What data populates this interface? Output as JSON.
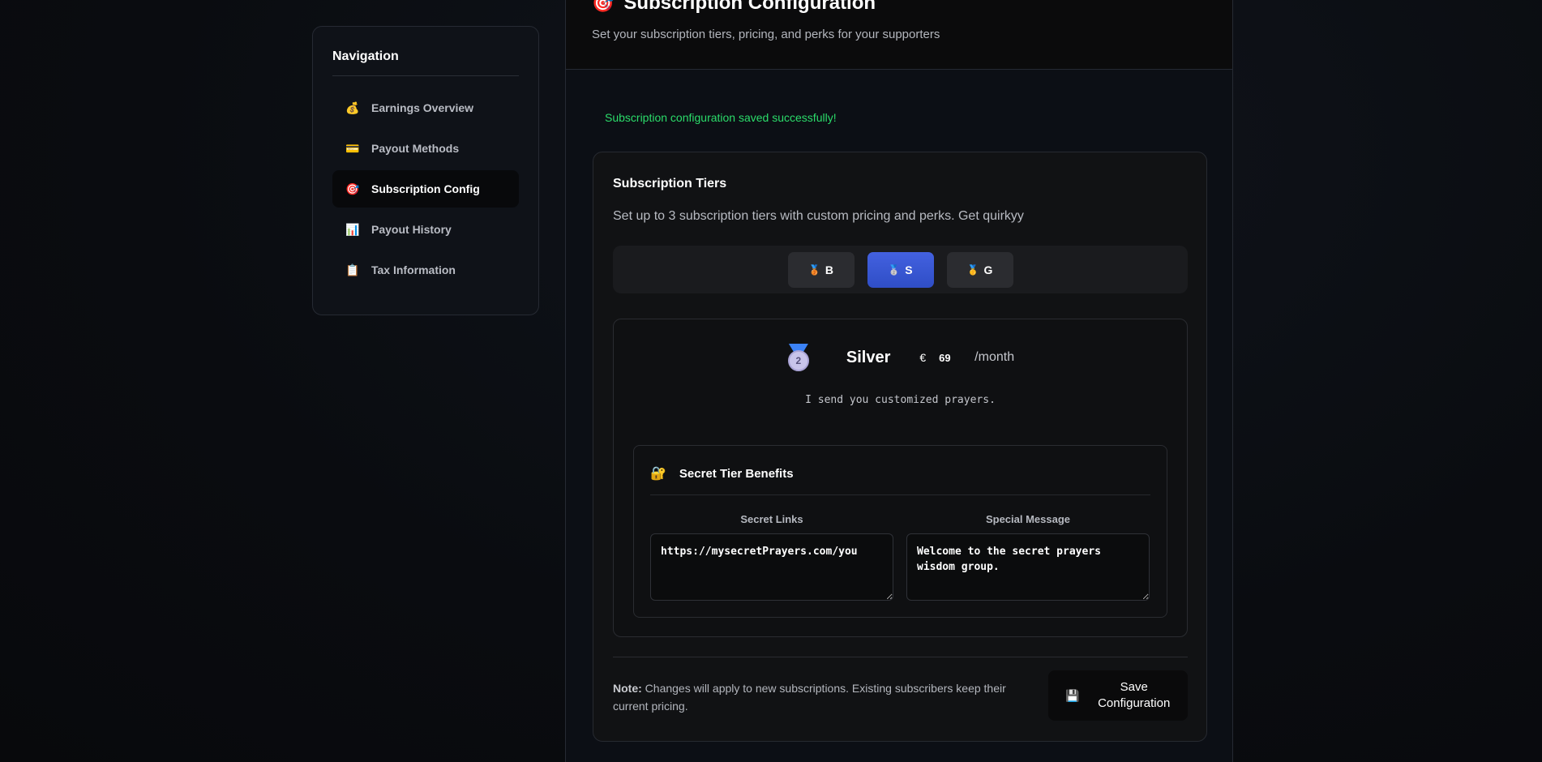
{
  "sidebar": {
    "title": "Navigation",
    "items": [
      {
        "icon": "💰",
        "label": "Earnings Overview"
      },
      {
        "icon": "💳",
        "label": "Payout Methods"
      },
      {
        "icon": "🎯",
        "label": "Subscription Config"
      },
      {
        "icon": "📊",
        "label": "Payout History"
      },
      {
        "icon": "📋",
        "label": "Tax Information"
      }
    ]
  },
  "header": {
    "icon": "🎯",
    "title": "Subscription Configuration",
    "subtitle": "Set your subscription tiers, pricing, and perks for your supporters"
  },
  "status": {
    "message": "Subscription configuration saved successfully!"
  },
  "tiers_card": {
    "title": "Subscription Tiers",
    "description": "Set up to 3 subscription tiers with custom pricing and perks. Get quirkyy",
    "tabs": [
      {
        "icon": "🥉",
        "label": "B"
      },
      {
        "icon": "🥈",
        "label": "S"
      },
      {
        "icon": "🥇",
        "label": "G"
      }
    ],
    "selected_tier": {
      "medal_number": "2",
      "name": "Silver",
      "currency": "€",
      "price": "69",
      "period": "/month",
      "description": "I send you customized prayers."
    },
    "secret": {
      "icon": "🔐",
      "title": "Secret Tier Benefits",
      "links_label": "Secret Links",
      "links_value": "https://mysecretPrayers.com/you",
      "message_label": "Special Message",
      "message_value": "Welcome to the secret prayers wisdom group."
    },
    "note_label": "Note:",
    "note_text": " Changes will apply to new subscriptions. Existing subscribers keep their current pricing.",
    "save_icon": "💾",
    "save_label": "Save Configuration"
  },
  "colors": {
    "accent": "#3b5bdb",
    "success": "#2bdc6a"
  }
}
